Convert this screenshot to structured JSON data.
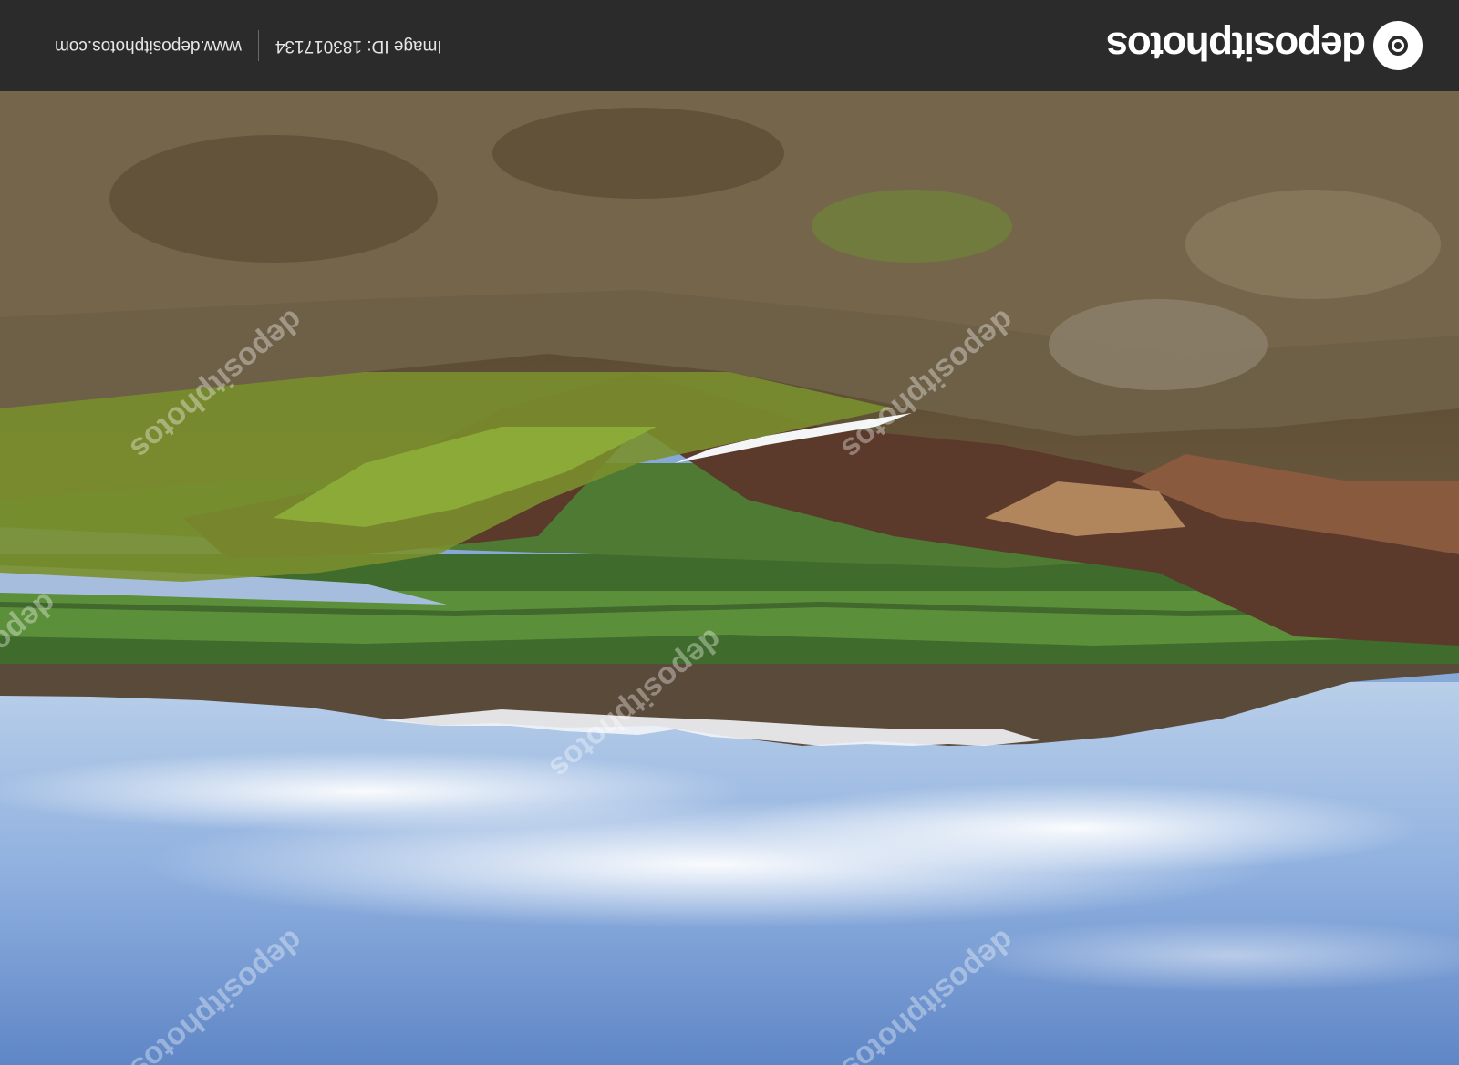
{
  "brand": {
    "name": "depositphotos",
    "accent": "#ffffff",
    "bar_color": "#2b2b2b"
  },
  "footer": {
    "image_id_label": "Image ID:",
    "image_id": "183017134",
    "site": "www.depositphotos.com"
  },
  "watermark": {
    "text": "depositphotos"
  },
  "icons": [
    "camera-logo-icon"
  ]
}
